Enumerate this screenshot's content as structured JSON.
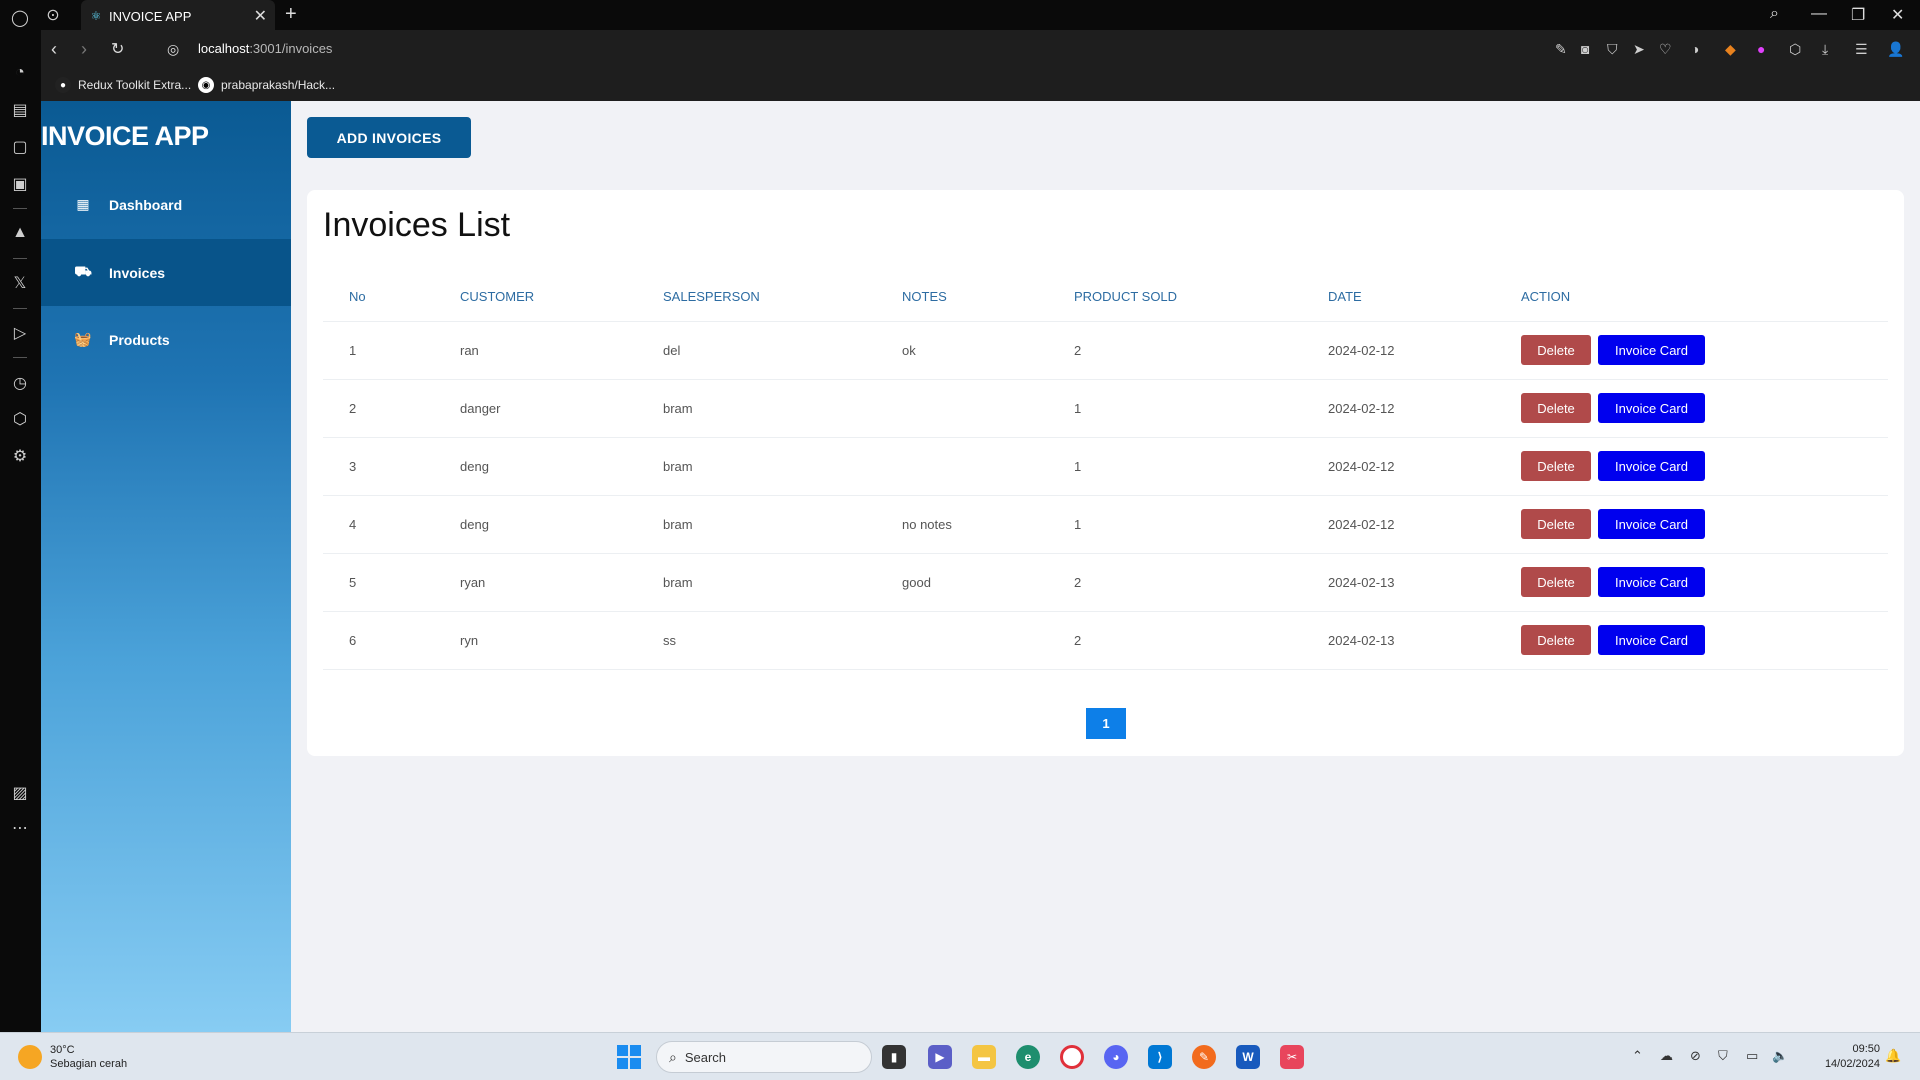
{
  "browser": {
    "tab_title": "INVOICE APP",
    "url_host": "localhost",
    "url_path": ":3001/invoices",
    "bookmarks": [
      "Redux Toolkit Extra...",
      "prabaprakash/Hack..."
    ]
  },
  "sidebar": {
    "brand": "INVOICE APP",
    "items": [
      {
        "label": "Dashboard",
        "icon": "dashboard-icon",
        "active": false
      },
      {
        "label": "Invoices",
        "icon": "truck-icon",
        "active": true
      },
      {
        "label": "Products",
        "icon": "basket-icon",
        "active": false
      }
    ]
  },
  "main": {
    "add_button": "ADD INVOICES",
    "title": "Invoices List",
    "columns": [
      "No",
      "CUSTOMER",
      "SALESPERSON",
      "NOTES",
      "PRODUCT SOLD",
      "DATE",
      "ACTION"
    ],
    "rows": [
      {
        "no": "1",
        "customer": "ran",
        "salesperson": "del",
        "notes": "ok",
        "sold": "2",
        "date": "2024-02-12"
      },
      {
        "no": "2",
        "customer": "danger",
        "salesperson": "bram",
        "notes": "",
        "sold": "1",
        "date": "2024-02-12"
      },
      {
        "no": "3",
        "customer": "deng",
        "salesperson": "bram",
        "notes": "",
        "sold": "1",
        "date": "2024-02-12"
      },
      {
        "no": "4",
        "customer": "deng",
        "salesperson": "bram",
        "notes": "no notes",
        "sold": "1",
        "date": "2024-02-12"
      },
      {
        "no": "5",
        "customer": "ryan",
        "salesperson": "bram",
        "notes": "good",
        "sold": "2",
        "date": "2024-02-13"
      },
      {
        "no": "6",
        "customer": "ryn",
        "salesperson": "ss",
        "notes": "",
        "sold": "2",
        "date": "2024-02-13"
      }
    ],
    "delete_label": "Delete",
    "card_label": "Invoice Card",
    "page": "1"
  },
  "taskbar": {
    "temperature": "30°C",
    "weather": "Sebagian cerah",
    "search_placeholder": "Search",
    "time": "09:50",
    "date": "14/02/2024"
  },
  "colors": {
    "primary": "#0a5a93",
    "delete": "#b04a4a",
    "invoice_card": "#0000ee",
    "pagination": "#0d7fe8"
  }
}
